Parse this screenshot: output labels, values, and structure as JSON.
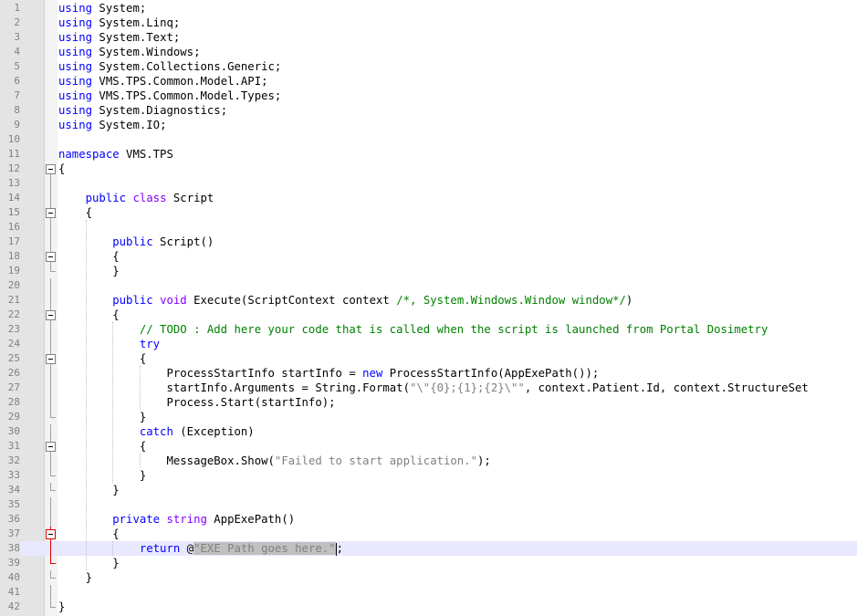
{
  "editor": {
    "current_line": 38,
    "lines": [
      {
        "n": "1",
        "fold": "",
        "segs": [
          {
            "c": "kw",
            "t": "using"
          },
          {
            "c": "",
            "t": " System;"
          }
        ]
      },
      {
        "n": "2",
        "fold": "",
        "segs": [
          {
            "c": "kw",
            "t": "using"
          },
          {
            "c": "",
            "t": " System.Linq;"
          }
        ]
      },
      {
        "n": "3",
        "fold": "",
        "segs": [
          {
            "c": "kw",
            "t": "using"
          },
          {
            "c": "",
            "t": " System.Text;"
          }
        ]
      },
      {
        "n": "4",
        "fold": "",
        "segs": [
          {
            "c": "kw",
            "t": "using"
          },
          {
            "c": "",
            "t": " System.Windows;"
          }
        ]
      },
      {
        "n": "5",
        "fold": "",
        "segs": [
          {
            "c": "kw",
            "t": "using"
          },
          {
            "c": "",
            "t": " System.Collections.Generic;"
          }
        ]
      },
      {
        "n": "6",
        "fold": "",
        "segs": [
          {
            "c": "kw",
            "t": "using"
          },
          {
            "c": "",
            "t": " VMS.TPS.Common.Model.API;"
          }
        ]
      },
      {
        "n": "7",
        "fold": "",
        "segs": [
          {
            "c": "kw",
            "t": "using"
          },
          {
            "c": "",
            "t": " VMS.TPS.Common.Model.Types;"
          }
        ]
      },
      {
        "n": "8",
        "fold": "",
        "segs": [
          {
            "c": "kw",
            "t": "using"
          },
          {
            "c": "",
            "t": " System.Diagnostics;"
          }
        ]
      },
      {
        "n": "9",
        "fold": "",
        "segs": [
          {
            "c": "kw",
            "t": "using"
          },
          {
            "c": "",
            "t": " System.IO;"
          }
        ]
      },
      {
        "n": "10",
        "fold": "",
        "segs": []
      },
      {
        "n": "11",
        "fold": "",
        "segs": [
          {
            "c": "kw",
            "t": "namespace"
          },
          {
            "c": "",
            "t": " VMS.TPS"
          }
        ]
      },
      {
        "n": "12",
        "fold": "top",
        "segs": [
          {
            "c": "",
            "t": "{"
          }
        ]
      },
      {
        "n": "13",
        "fold": "line",
        "segs": []
      },
      {
        "n": "14",
        "fold": "line",
        "segs": [
          {
            "c": "",
            "t": "    "
          },
          {
            "c": "kw",
            "t": "public"
          },
          {
            "c": "",
            "t": " "
          },
          {
            "c": "kw2",
            "t": "class"
          },
          {
            "c": "",
            "t": " Script"
          }
        ]
      },
      {
        "n": "15",
        "fold": "box",
        "segs": [
          {
            "c": "",
            "t": "    {"
          }
        ]
      },
      {
        "n": "16",
        "fold": "line",
        "segs": []
      },
      {
        "n": "17",
        "fold": "line",
        "segs": [
          {
            "c": "",
            "t": "        "
          },
          {
            "c": "kw",
            "t": "public"
          },
          {
            "c": "",
            "t": " Script()"
          }
        ]
      },
      {
        "n": "18",
        "fold": "box",
        "segs": [
          {
            "c": "",
            "t": "        {"
          }
        ]
      },
      {
        "n": "19",
        "fold": "end",
        "segs": [
          {
            "c": "",
            "t": "        }"
          }
        ]
      },
      {
        "n": "20",
        "fold": "line",
        "segs": []
      },
      {
        "n": "21",
        "fold": "line",
        "segs": [
          {
            "c": "",
            "t": "        "
          },
          {
            "c": "kw",
            "t": "public"
          },
          {
            "c": "",
            "t": " "
          },
          {
            "c": "kw2",
            "t": "void"
          },
          {
            "c": "",
            "t": " Execute(ScriptContext context "
          },
          {
            "c": "cm",
            "t": "/*, System.Windows.Window window*/"
          },
          {
            "c": "",
            "t": ")"
          }
        ]
      },
      {
        "n": "22",
        "fold": "box",
        "segs": [
          {
            "c": "",
            "t": "        {"
          }
        ]
      },
      {
        "n": "23",
        "fold": "line",
        "segs": [
          {
            "c": "",
            "t": "            "
          },
          {
            "c": "cm",
            "t": "// TODO : Add here your code that is called when the script is launched from Portal Dosimetry"
          }
        ]
      },
      {
        "n": "24",
        "fold": "line",
        "segs": [
          {
            "c": "",
            "t": "            "
          },
          {
            "c": "kw",
            "t": "try"
          }
        ]
      },
      {
        "n": "25",
        "fold": "box",
        "segs": [
          {
            "c": "",
            "t": "            {"
          }
        ]
      },
      {
        "n": "26",
        "fold": "line",
        "segs": [
          {
            "c": "",
            "t": "                ProcessStartInfo startInfo = "
          },
          {
            "c": "kw",
            "t": "new"
          },
          {
            "c": "",
            "t": " ProcessStartInfo(AppExePath());"
          }
        ]
      },
      {
        "n": "27",
        "fold": "line",
        "segs": [
          {
            "c": "",
            "t": "                startInfo.Arguments = String.Format("
          },
          {
            "c": "str",
            "t": "\"\\\"{0};{1};{2}\\\"\""
          },
          {
            "c": "",
            "t": ", context.Patient.Id, context.StructureSet"
          }
        ]
      },
      {
        "n": "28",
        "fold": "line",
        "segs": [
          {
            "c": "",
            "t": "                Process.Start(startInfo);"
          }
        ]
      },
      {
        "n": "29",
        "fold": "end",
        "segs": [
          {
            "c": "",
            "t": "            }"
          }
        ]
      },
      {
        "n": "30",
        "fold": "line",
        "segs": [
          {
            "c": "",
            "t": "            "
          },
          {
            "c": "kw",
            "t": "catch"
          },
          {
            "c": "",
            "t": " (Exception)"
          }
        ]
      },
      {
        "n": "31",
        "fold": "box",
        "segs": [
          {
            "c": "",
            "t": "            {"
          }
        ]
      },
      {
        "n": "32",
        "fold": "line",
        "segs": [
          {
            "c": "",
            "t": "                MessageBox.Show("
          },
          {
            "c": "str",
            "t": "\"Failed to start application.\""
          },
          {
            "c": "",
            "t": ");"
          }
        ]
      },
      {
        "n": "33",
        "fold": "end",
        "segs": [
          {
            "c": "",
            "t": "            }"
          }
        ]
      },
      {
        "n": "34",
        "fold": "end",
        "segs": [
          {
            "c": "",
            "t": "        }"
          }
        ]
      },
      {
        "n": "35",
        "fold": "line",
        "segs": []
      },
      {
        "n": "36",
        "fold": "line",
        "segs": [
          {
            "c": "",
            "t": "        "
          },
          {
            "c": "kw",
            "t": "private"
          },
          {
            "c": "",
            "t": " "
          },
          {
            "c": "kw2",
            "t": "string"
          },
          {
            "c": "",
            "t": " AppExePath()"
          }
        ]
      },
      {
        "n": "37",
        "fold": "box red",
        "segs": [
          {
            "c": "",
            "t": "        {"
          }
        ]
      },
      {
        "n": "38",
        "fold": "line red",
        "segs": [
          {
            "c": "",
            "t": "            "
          },
          {
            "c": "kw",
            "t": "return"
          },
          {
            "c": "",
            "t": " @"
          },
          {
            "c": "str sel",
            "t": "\"EXE Path goes here.\""
          },
          {
            "c": "caret",
            "t": ""
          },
          {
            "c": "",
            "t": ";"
          }
        ]
      },
      {
        "n": "39",
        "fold": "end red",
        "segs": [
          {
            "c": "",
            "t": "        }"
          }
        ]
      },
      {
        "n": "40",
        "fold": "end",
        "segs": [
          {
            "c": "",
            "t": "    }"
          }
        ]
      },
      {
        "n": "41",
        "fold": "line",
        "segs": []
      },
      {
        "n": "42",
        "fold": "end",
        "segs": [
          {
            "c": "",
            "t": "}"
          }
        ]
      }
    ]
  }
}
